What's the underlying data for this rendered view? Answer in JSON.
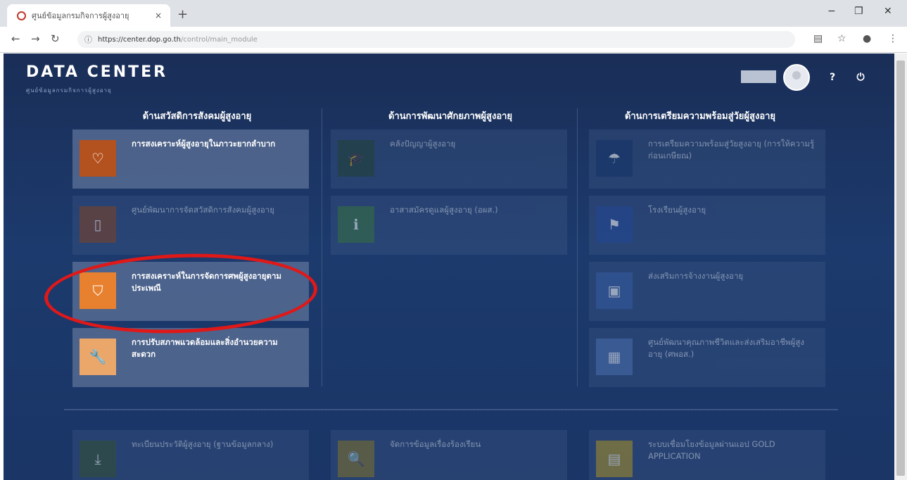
{
  "browser": {
    "tab_title": "ศูนย์ข้อมูลกรมกิจการผู้สูงอายุ",
    "url_host": "https://center.dop.go.th",
    "url_path": "/control/main_module",
    "new_tab": "+",
    "close_tab": "×",
    "minimize": "−",
    "maximize": "❐",
    "close_window": "✕"
  },
  "header": {
    "title": "DATA CENTER",
    "subtitle": "ศูนย์ข้อมูลกรมกิจการผู้สูงอายุ"
  },
  "columns": [
    {
      "heading": "ด้านสวัสดิการสังคมผู้สูงอายุ"
    },
    {
      "heading": "ด้านการพัฒนาศักยภาพผู้สูงอายุ"
    },
    {
      "heading": "ด้านการเตรียมความพร้อมสู่วัยผู้สูงอายุ"
    }
  ],
  "cards": {
    "welfare_hardship": "การสงเคราะห์ผู้สูงอายุในภาวะยากลำบาก",
    "welfare_center": "ศูนย์พัฒนาการจัดสวัสดิการสังคมผู้สูงอายุ",
    "funeral_aid": "การสงเคราะห์ในการจัดการศพผู้สูงอายุตามประเพณี",
    "home_repair": "การปรับสภาพแวดล้อมและสิ่งอำนวยความสะดวก",
    "elderly_wisdom": "คลังปัญญาผู้สูงอายุ",
    "elderly_volunteer": "อาสาสมัครดูแลผู้สูงอายุ (อผส.)",
    "pre_aging_prep": "การเตรียมความพร้อมสู่วัยสูงอายุ (การให้ความรู้ก่อนเกษียณ)",
    "elderly_school": "โรงเรียนผู้สูงอายุ",
    "elderly_job": "ส่งเสริมการจ้างงานผู้สูงอายุ",
    "quality_center": "ศูนย์พัฒนาคุณภาพชีวิตและส่งเสริมอาชีพผู้สูงอายุ (ศพอส.)",
    "elderly_registry": "ทะเบียนประวัติผู้สูงอายุ (ฐานข้อมูลกลาง)",
    "search_info": "จัดการข้อมูลเรื่องร้องเรียน",
    "gold_app": "ระบบเชื่อมโยงข้อมูลผ่านแอป GOLD APPLICATION"
  },
  "icons": {
    "heart": "♡",
    "book": "▯",
    "bookmark": "⛉",
    "wrench": "🔧",
    "cap": "🎓",
    "info": "ℹ",
    "umbrella": "☂",
    "flag": "⚑",
    "briefcase": "▣",
    "group": "▦",
    "download": "⤓",
    "search": "🔍",
    "doc": "▤",
    "help": "?",
    "power": "⏻"
  },
  "colors": {
    "page_bg": "#1c3a6d",
    "heart_icon": "#b4521f",
    "bookmark_icon": "#e8812f",
    "wrench_icon": "#eba66a",
    "highlight": "#e01818"
  }
}
